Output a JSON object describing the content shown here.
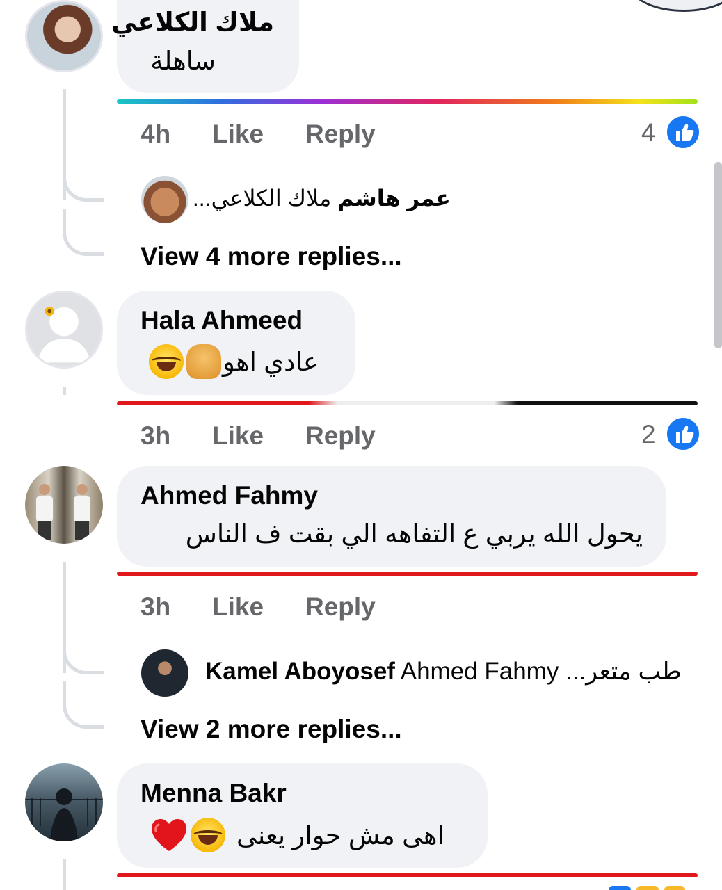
{
  "comments": [
    {
      "author": "ملاك الكلاعي",
      "text": "ساهلة",
      "time": "4h",
      "like_label": "Like",
      "reply_label": "Reply",
      "reaction_count": "4",
      "reply_preview": {
        "author": "عمر هاشم",
        "text": "ملاك الكلاعي..."
      },
      "view_more": "View 4 more replies..."
    },
    {
      "author": "Hala Ahmeed",
      "text": "عادي اهو",
      "time": "3h",
      "like_label": "Like",
      "reply_label": "Reply",
      "reaction_count": "2"
    },
    {
      "author": "Ahmed Fahmy",
      "text": "يحول الله يربي ع التفاهه الي بقت ف الناس",
      "time": "3h",
      "like_label": "Like",
      "reply_label": "Reply",
      "reply_preview": {
        "author": "Kamel Aboyosef",
        "mention": "Ahmed Fahmy",
        "text": "طب متعر..."
      },
      "view_more": "View 2 more replies..."
    },
    {
      "author": "Menna Bakr",
      "text": "اهى مش حوار يعنى"
    }
  ],
  "colors": {
    "bubble": "#f0f2f5",
    "meta_text": "#65676b",
    "like_blue": "#1877f2",
    "thread_line": "#dadde1"
  },
  "icons": [
    "like-thumb-icon",
    "laughing-tears-emoji",
    "shrug-emoji",
    "red-heart-emoji"
  ]
}
